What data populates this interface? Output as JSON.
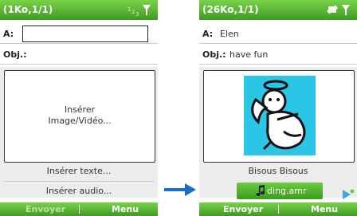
{
  "left_screen": {
    "title": "(1Ko,1/1)",
    "to_label": "A:",
    "to_value": "",
    "subject_label": "Obj.:",
    "subject_value": "",
    "insert_media_line1": "Insérer",
    "insert_media_line2": "Image/Vidéo...",
    "insert_text": "Insérer texte...",
    "insert_audio": "Insérer audio...",
    "softkey_left": "Envoyer",
    "softkey_right": "Menu",
    "softkey_left_enabled": false
  },
  "right_screen": {
    "title": "(26Ko,1/1)",
    "to_label": "A:",
    "to_value": "Elen",
    "subject_label": "Obj.:",
    "subject_value": "have fun",
    "image_name": "angel-image",
    "caption": "Bisous Bisous",
    "audio_file": "ding.amr",
    "softkey_left": "Envoyer",
    "softkey_right": "Menu",
    "softkey_left_enabled": true
  },
  "colors": {
    "accent_green": "#4aa827",
    "image_bg": "#2bc6e6"
  }
}
